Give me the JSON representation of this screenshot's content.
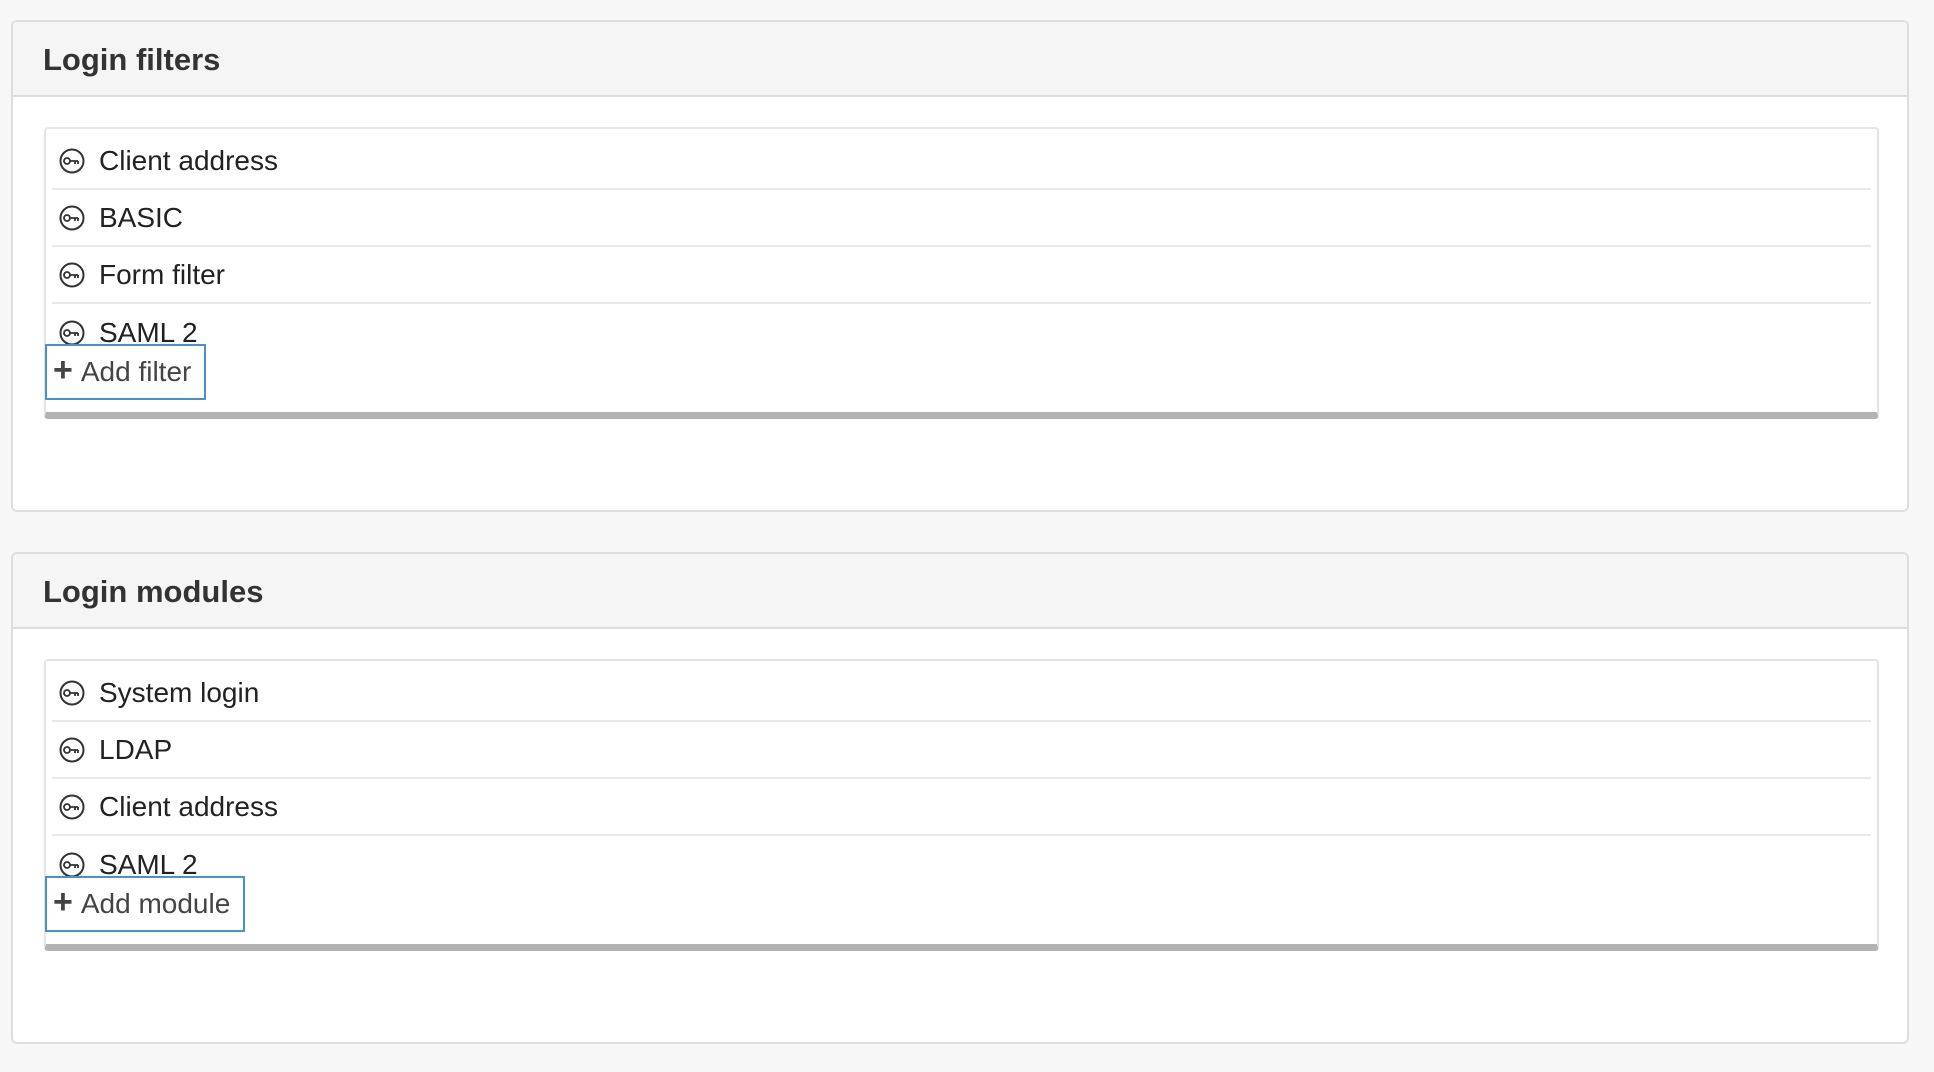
{
  "filters": {
    "title": "Login filters",
    "items": [
      {
        "label": "Client address",
        "icon": "key-circle-icon"
      },
      {
        "label": "BASIC",
        "icon": "key-circle-icon"
      },
      {
        "label": "Form filter",
        "icon": "key-circle-icon"
      },
      {
        "label": "SAML 2",
        "icon": "key-circle-icon"
      }
    ],
    "add_label": "Add filter",
    "add_icon": "plus-icon"
  },
  "modules": {
    "title": "Login modules",
    "items": [
      {
        "label": "System login",
        "icon": "key-circle-icon"
      },
      {
        "label": "LDAP",
        "icon": "key-circle-icon"
      },
      {
        "label": "Client address",
        "icon": "key-circle-icon"
      },
      {
        "label": "SAML 2",
        "icon": "key-circle-icon"
      }
    ],
    "add_label": "Add module",
    "add_icon": "plus-icon"
  },
  "colors": {
    "button_border": "#4a90c9",
    "panel_heading_bg": "#f5f5f5",
    "page_bg": "#f7f7f7"
  }
}
